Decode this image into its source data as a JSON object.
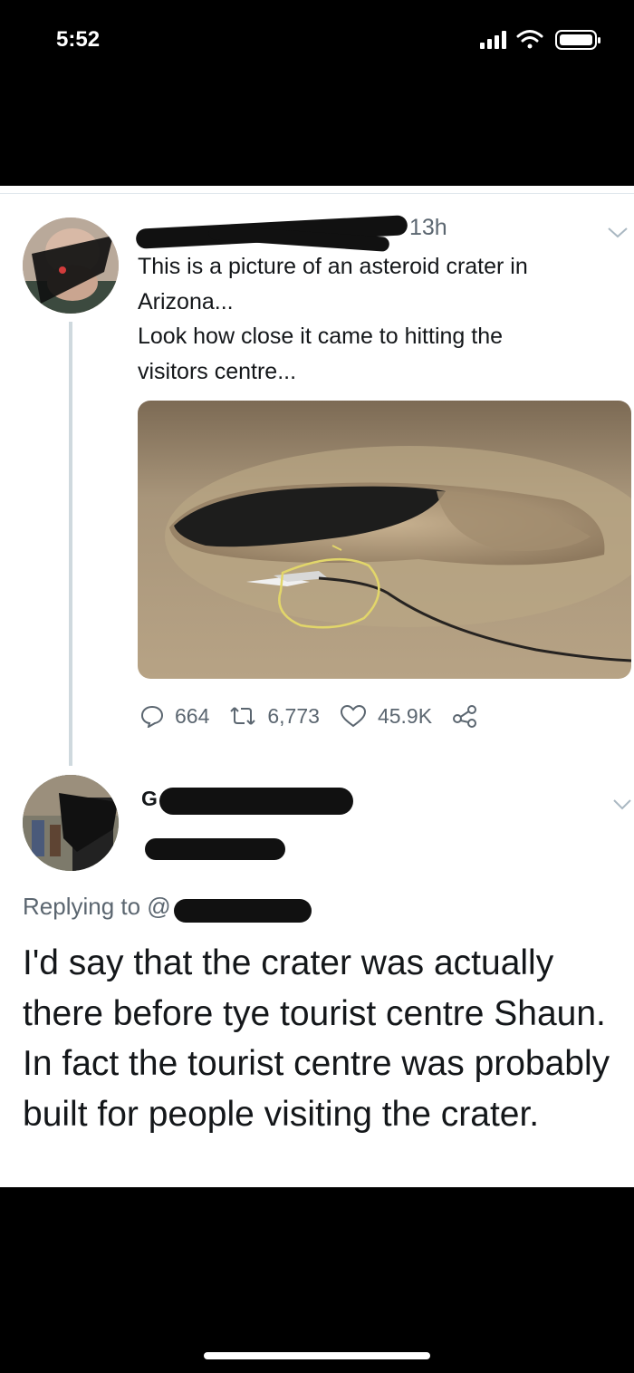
{
  "status_bar": {
    "time": "5:52"
  },
  "tweet": {
    "time_ago": "13h",
    "text_line1": "This is a picture of an asteroid crater in",
    "text_line2": "Arizona...",
    "text_line3": "Look how close it came to hitting the",
    "text_line4": "visitors centre...",
    "stats": {
      "replies": "664",
      "retweets": "6,773",
      "likes": "45.9K"
    }
  },
  "reply": {
    "name_partial": "G",
    "replying_to_label": "Replying to @",
    "text": "I'd say that the crater was actually there before tye tourist centre Shaun. In fact the tourist centre was probably built for people visiting the crater."
  },
  "icons": [
    "signal-icon",
    "wifi-icon",
    "battery-icon",
    "chevron-down-icon",
    "reply-icon",
    "retweet-icon",
    "like-icon",
    "share-icon"
  ],
  "colors": {
    "text": "#14171a",
    "secondary": "#5b6670",
    "thread_line": "#cfd9de",
    "highlight_circle": "#e2d66a"
  }
}
